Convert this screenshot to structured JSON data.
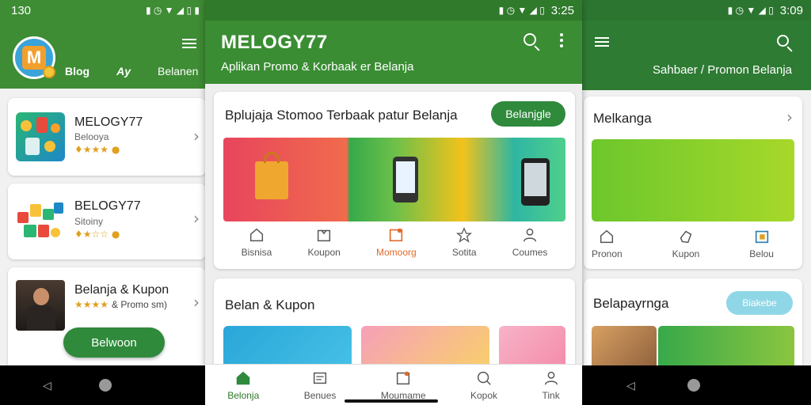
{
  "left": {
    "time": "130",
    "nav": [
      "Blog",
      "Ay",
      "Belanen"
    ],
    "apps": [
      {
        "name": "MELOGY77",
        "sub": "Belooya"
      },
      {
        "name": "BELOGY77",
        "sub": "Sitoiny"
      },
      {
        "name": "Belanja & Kupon",
        "sub": "& Promo sm)"
      }
    ],
    "fab": "Belwoon"
  },
  "center": {
    "time": "3:25",
    "app_title": "MELOGY77",
    "subtitle": "Aplikan Promo & Korbaak er Belanja",
    "card1_title": "Bplujaja Stomoo  Terbaak patur Belanja",
    "card1_button": "Belanjgle",
    "card1_tabs": [
      "Bisnisa",
      "Koupon",
      "Momoorg",
      "Sotita",
      "Coumes"
    ],
    "card2_title": "Belan & Kupon",
    "bottom_tabs": [
      "Belonja",
      "Benues",
      "Moumame",
      "Kopok",
      "Tink"
    ]
  },
  "right": {
    "time": "3:09",
    "header_text": "Sahbaer / Promon Belanja",
    "card1_title": "Melkanga",
    "card1_tabs": [
      "Pronon",
      "Kupon",
      "Belou"
    ],
    "card2_title": "Belapayrnga",
    "card2_button": "Biakebe"
  },
  "colors": {
    "green": "#3a8d33",
    "accent_orange": "#e06a2a"
  }
}
